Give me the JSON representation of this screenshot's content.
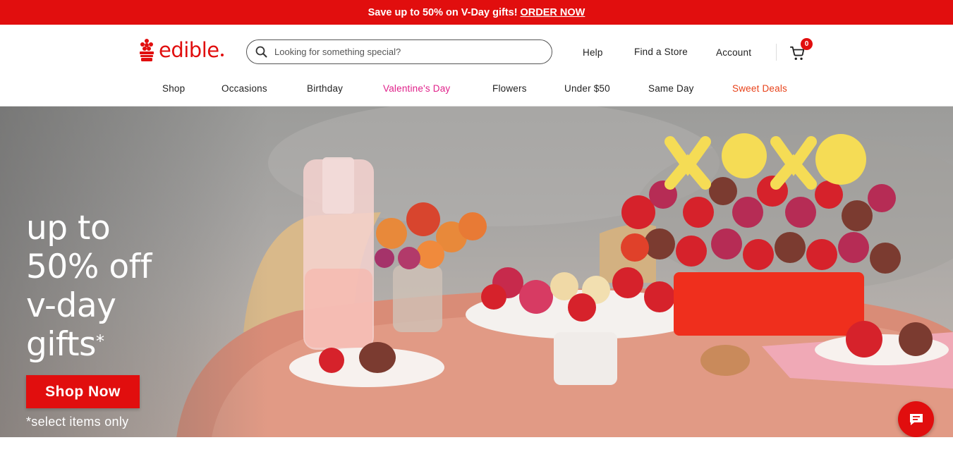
{
  "promo": {
    "text": "Save up to 50% on V-Day gifts!",
    "link": "ORDER NOW",
    "bg_color": "#e10e0e"
  },
  "header": {
    "logo_text": "edible",
    "search": {
      "placeholder": "Looking for something special?",
      "value": ""
    },
    "utility": {
      "help": "Help",
      "find_store": "Find a Store",
      "account": "Account"
    },
    "cart": {
      "count": "0",
      "icon": "cart-icon"
    }
  },
  "nav": {
    "items": [
      {
        "label": "Shop",
        "color": "#222222"
      },
      {
        "label": "Occasions",
        "color": "#222222"
      },
      {
        "label": "Birthday",
        "color": "#222222"
      },
      {
        "label": "Valentine's Day",
        "color": "#e0218a"
      },
      {
        "label": "Flowers",
        "color": "#222222"
      },
      {
        "label": "Under $50",
        "color": "#222222"
      },
      {
        "label": "Same Day",
        "color": "#222222"
      },
      {
        "label": "Sweet Deals",
        "color": "#e8421a"
      }
    ]
  },
  "hero": {
    "headline": [
      "up to",
      "50% off",
      "v-day",
      "gifts"
    ],
    "asterisk": "*",
    "cta": "Shop Now",
    "disclaimer": "*select items only"
  },
  "chat": {
    "icon": "chat-icon"
  },
  "colors": {
    "brand_red": "#e10e0e",
    "valentine_pink": "#e0218a",
    "deals_orange": "#e8421a"
  }
}
